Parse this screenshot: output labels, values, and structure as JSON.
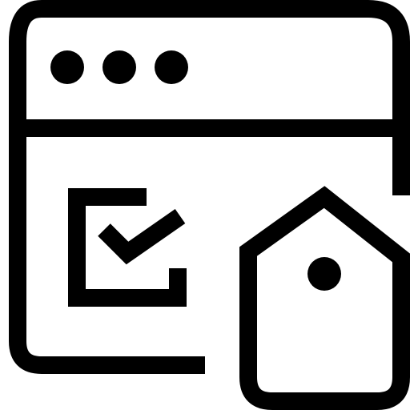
{
  "icon": {
    "name": "browser-window-checklist-tag-icon",
    "stroke_color": "#000000",
    "background_color": "#ffffff",
    "window_control_dots": 3
  }
}
